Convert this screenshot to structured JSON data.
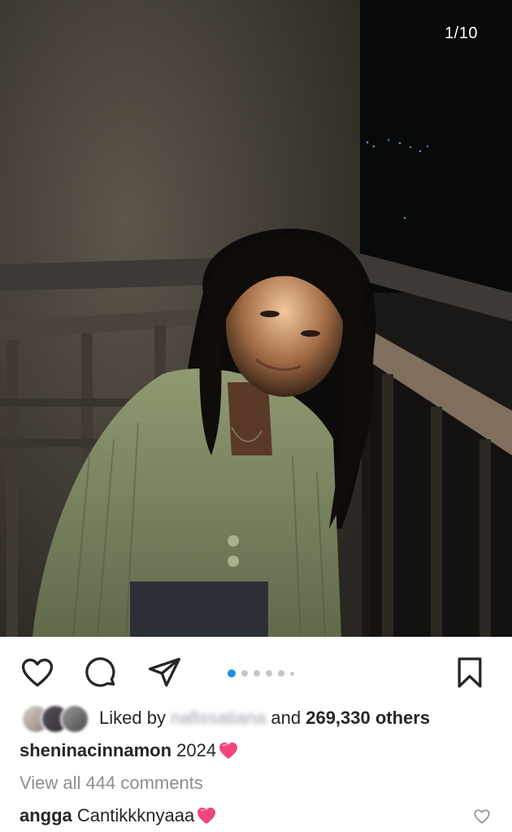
{
  "post": {
    "slide_counter": "1/10",
    "carousel": {
      "total": 6,
      "active_index": 0
    }
  },
  "likes": {
    "prefix": "Liked by",
    "blurred_user": "nafissatiana",
    "suffix_and": "and",
    "count_text": "269,330 others"
  },
  "caption": {
    "username": "sheninacinnamon",
    "text": "2024"
  },
  "comments": {
    "view_all": "View all 444 comments",
    "items": [
      {
        "username": "angga",
        "text": "Cantikkknyaaa"
      }
    ]
  },
  "icons": {
    "like": "heart-outline-icon",
    "comment": "comment-bubble-icon",
    "share": "paper-plane-icon",
    "save": "bookmark-icon",
    "emoji": "pink-heart-emoji"
  },
  "colors": {
    "accent": "#1d8fe1",
    "heart_pink": "#f0467c",
    "muted": "#8e8e8e",
    "text": "#262626"
  }
}
